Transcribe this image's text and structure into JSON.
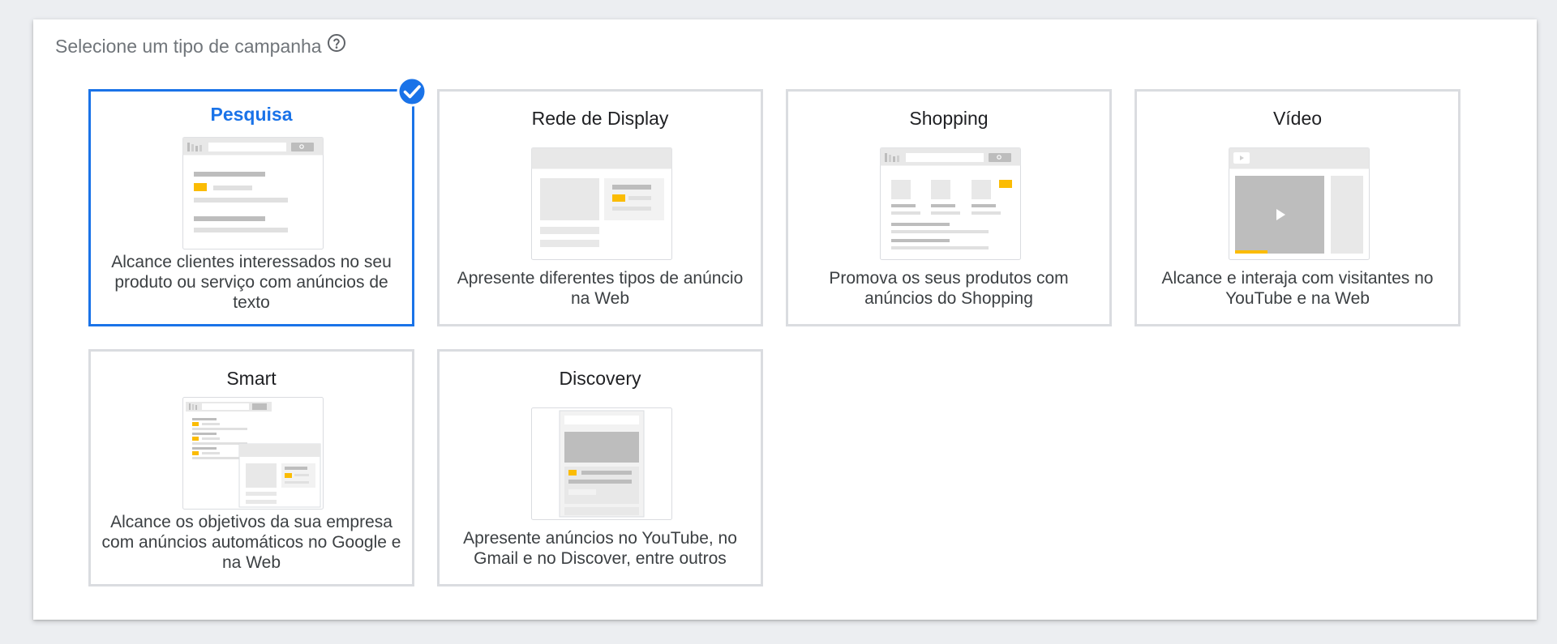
{
  "heading": {
    "label": "Selecione um tipo de campanha",
    "help_icon": "help-circle-icon"
  },
  "colors": {
    "selected": "#1a73e8",
    "border": "#dadce0",
    "accent": "#fbbc04"
  },
  "cards": [
    {
      "title": "Pesquisa",
      "description": "Alcance clientes interessados no seu produto ou serviço com anúncios de texto",
      "selected": true
    },
    {
      "title": "Rede de Display",
      "description": "Apresente diferentes tipos de anúncio na Web",
      "selected": false
    },
    {
      "title": "Shopping",
      "description": "Promova os seus produtos com anúncios do Shopping",
      "selected": false
    },
    {
      "title": "Vídeo",
      "description": "Alcance e interaja com visitantes no YouTube e na Web",
      "selected": false
    },
    {
      "title": "Smart",
      "description": "Alcance os objetivos da sua empresa com anúncios automáticos no Google e na Web",
      "selected": false
    },
    {
      "title": "Discovery",
      "description": "Apresente anúncios no YouTube, no Gmail e no Discover, entre outros",
      "selected": false
    }
  ]
}
